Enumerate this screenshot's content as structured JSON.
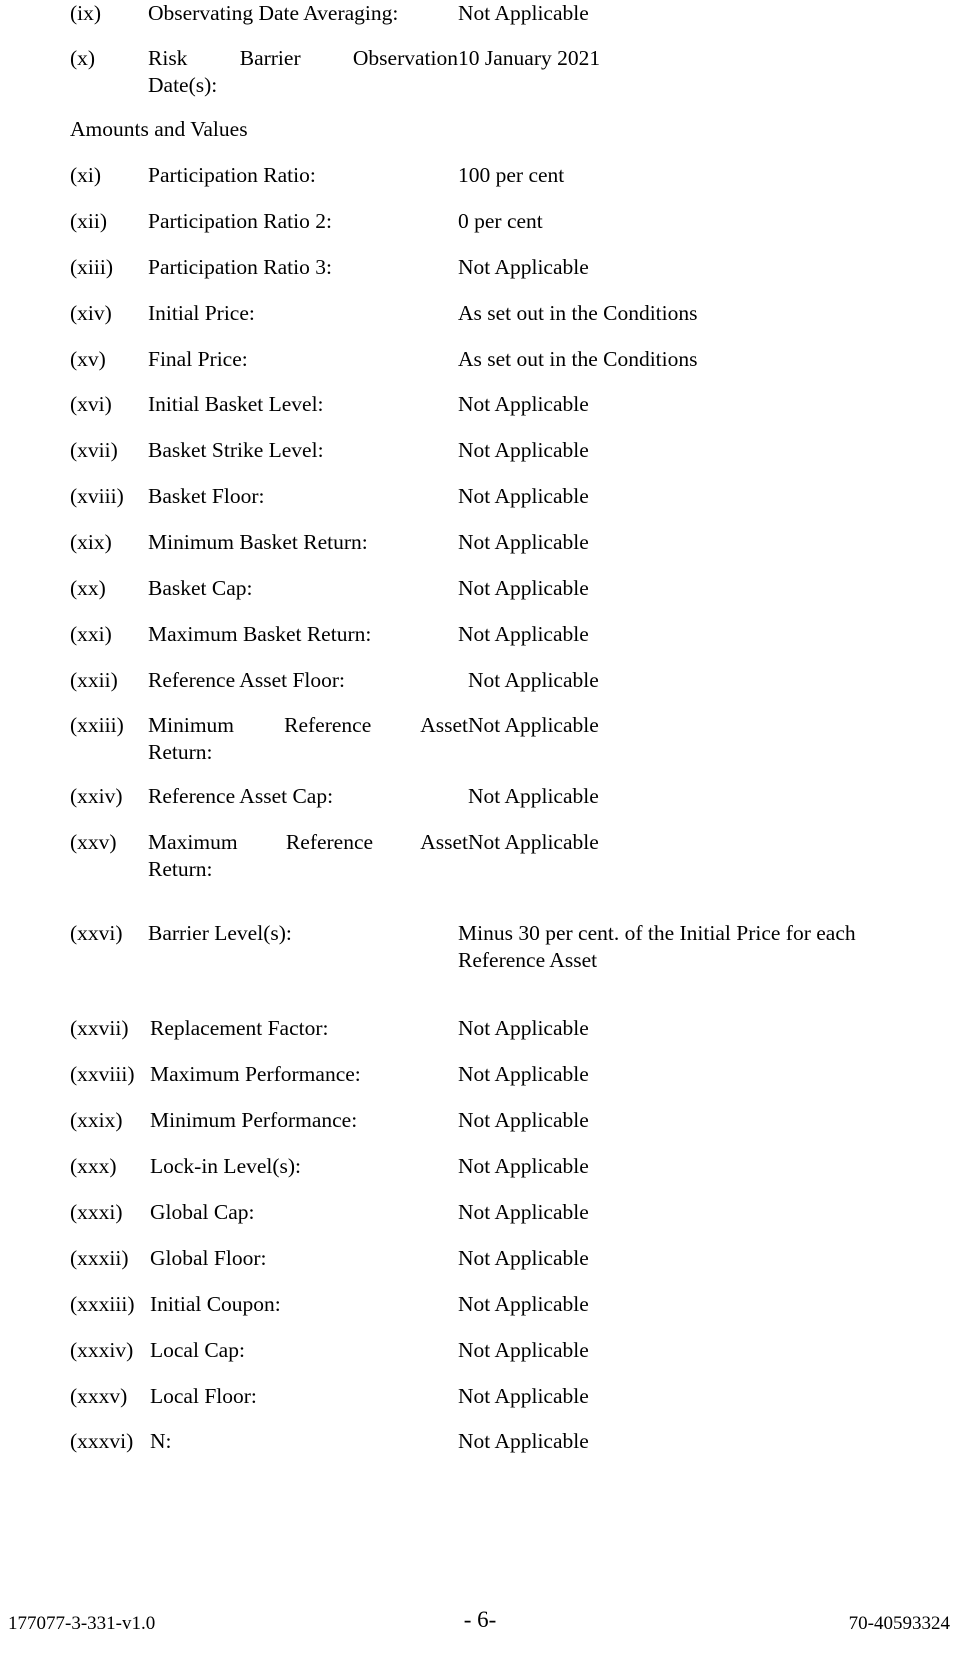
{
  "document": {
    "type": "final-terms-page",
    "page_label": "- 6-"
  },
  "top_rows": [
    {
      "numeral": "(ix)",
      "label": "Observating Date Averaging:",
      "value": "Not Applicable",
      "justified": false
    },
    {
      "numeral": "(x)",
      "label_line1": "Risk      Barrier      Observation",
      "label_line1_words": "Risk Barrier Observation",
      "label_line2": "Date(s):",
      "value": "10 January 2021",
      "justified": true
    }
  ],
  "section_heading": "Amounts and Values",
  "rows": [
    {
      "numeral": "(xi)",
      "label": "Participation Ratio:",
      "value": "100 per cent"
    },
    {
      "numeral": "(xii)",
      "label": "Participation Ratio 2:",
      "value": "0 per cent"
    },
    {
      "numeral": "(xiii)",
      "label": "Participation Ratio 3:",
      "value": "Not Applicable"
    },
    {
      "numeral": "(xiv)",
      "label": "Initial Price:",
      "value": "As set out in the Conditions"
    },
    {
      "numeral": "(xv)",
      "label": "Final Price:",
      "value": "As set out in the Conditions"
    },
    {
      "numeral": "(xvi)",
      "label": "Initial Basket Level:",
      "value": "Not Applicable"
    },
    {
      "numeral": "(xvii)",
      "label": "Basket Strike Level:",
      "value": "Not Applicable"
    },
    {
      "numeral": "(xviii)",
      "label": "Basket Floor:",
      "value": "Not Applicable"
    },
    {
      "numeral": "(xix)",
      "label": "Minimum Basket Return:",
      "value": "Not Applicable"
    },
    {
      "numeral": "(xx)",
      "label": "Basket Cap:",
      "value": "Not Applicable"
    },
    {
      "numeral": "(xxi)",
      "label": "Maximum Basket Return:",
      "value": "Not Applicable"
    }
  ],
  "ref_asset_rows": [
    {
      "numeral": "(xxii)",
      "label": "Reference Asset Floor:",
      "value": "Not Applicable"
    },
    {
      "numeral": "(xxiii)",
      "label_line1_words": "Minimum Reference Asset",
      "label_line2": "Return:",
      "value": "Not Applicable",
      "justified": true
    },
    {
      "numeral": "(xxiv)",
      "label": "Reference Asset Cap:",
      "value": "Not Applicable"
    },
    {
      "numeral": "(xxv)",
      "label_line1_words": "Maximum Reference Asset",
      "label_line2": "Return:",
      "value": "Not Applicable",
      "justified": true
    }
  ],
  "barrier_row": {
    "numeral": "(xxvi)",
    "label": "Barrier Level(s):",
    "value_line1": "Minus 30 per cent. of the Initial Price for each",
    "value_line2": "Reference Asset"
  },
  "bottom_rows": [
    {
      "numeral": "(xxvii)",
      "label": "Replacement Factor:",
      "value": "Not Applicable"
    },
    {
      "numeral": "(xxviii)",
      "label": "Maximum Performance:",
      "value": "Not Applicable"
    },
    {
      "numeral": "(xxix)",
      "label": "Minimum Performance:",
      "value": "Not Applicable"
    },
    {
      "numeral": "(xxx)",
      "label": "Lock-in Level(s):",
      "value": "Not Applicable"
    },
    {
      "numeral": "(xxxi)",
      "label": "Global Cap:",
      "value": "Not Applicable"
    },
    {
      "numeral": "(xxxii)",
      "label": "Global Floor:",
      "value": "Not Applicable"
    },
    {
      "numeral": "(xxxiii)",
      "label": "Initial Coupon:",
      "value": "Not Applicable"
    },
    {
      "numeral": "(xxxiv)",
      "label": "Local Cap:",
      "value": "Not Applicable"
    },
    {
      "numeral": "(xxxv)",
      "label": "Local Floor:",
      "value": "Not Applicable"
    },
    {
      "numeral": "(xxxvi)",
      "label": "N:",
      "value": "Not Applicable"
    }
  ],
  "footer": {
    "left": "177077-3-331-v1.0",
    "center": "- 6-",
    "right": "70-40593324"
  }
}
